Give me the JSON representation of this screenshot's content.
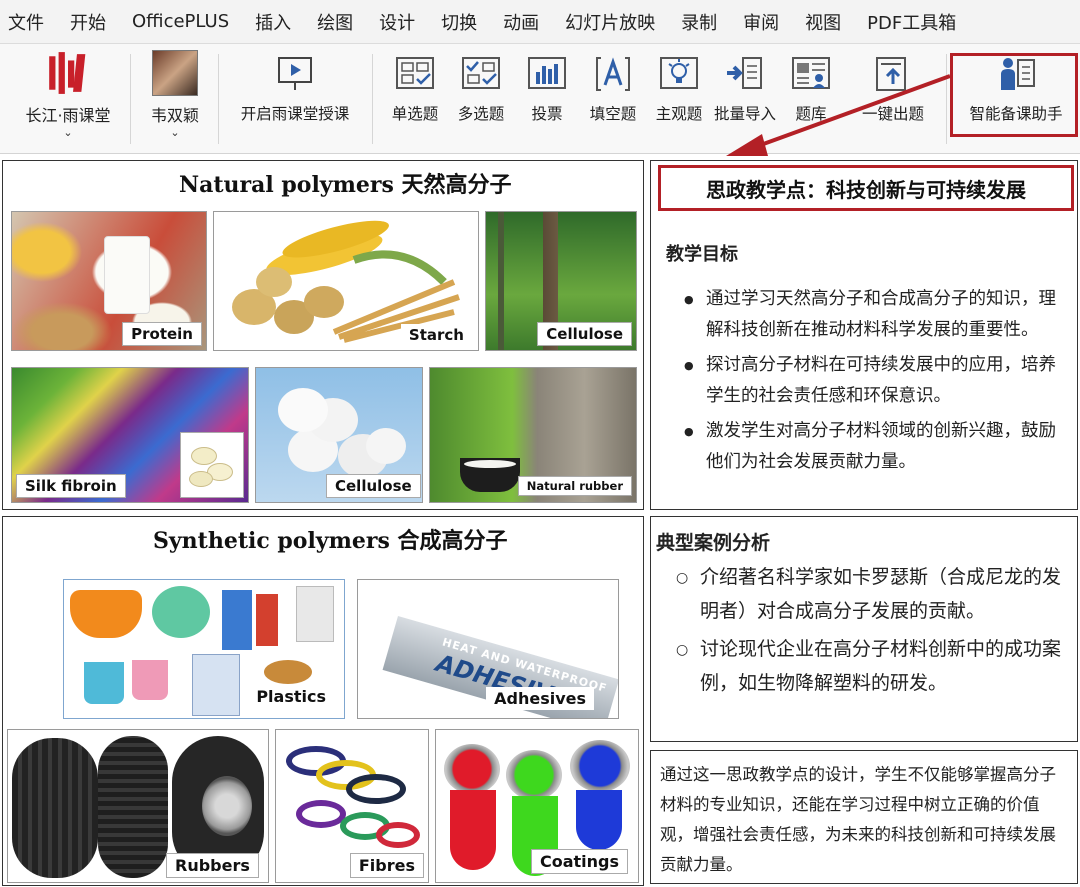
{
  "menubar": {
    "items": [
      "文件",
      "开始",
      "OfficePLUS",
      "插入",
      "绘图",
      "设计",
      "切换",
      "动画",
      "幻灯片放映",
      "录制",
      "审阅",
      "视图",
      "PDF工具箱"
    ]
  },
  "ribbon": {
    "rain_classroom": "长江·雨课堂",
    "user": "韦双颖",
    "start_lesson": "开启雨课堂授课",
    "buttons": [
      "单选题",
      "多选题",
      "投票",
      "填空题",
      "主观题",
      "批量导入",
      "题库",
      "一键出题"
    ],
    "assistant": "智能备课助手",
    "caret": "⌄"
  },
  "natural": {
    "title": "Natural polymers 天然高分子",
    "tags": [
      "Protein",
      "Starch",
      "Cellulose",
      "Silk fibroin",
      "Cellulose",
      "Natural rubber"
    ]
  },
  "synthetic": {
    "title": "Synthetic polymers  合成高分子",
    "tags": [
      "Plastics",
      "Adhesives",
      "Rubbers",
      "Fibres",
      "Coatings"
    ],
    "tube_text": "HEAT AND WATERPROOF",
    "tube_brand": "ADHESIVE"
  },
  "ideology": {
    "title": "思政教学点：科技创新与可持续发展",
    "goals_head": "教学目标",
    "goals": [
      "通过学习天然高分子和合成高分子的知识，理解科技创新在推动材料科学发展的重要性。",
      "探讨高分子材料在可持续发展中的应用，培养学生的社会责任感和环保意识。",
      "激发学生对高分子材料领域的创新兴趣，鼓励他们为社会发展贡献力量。"
    ],
    "cases_head": "典型案例分析",
    "cases": [
      "介绍著名科学家如卡罗瑟斯（合成尼龙的发明者）对合成高分子发展的贡献。",
      "讨论现代企业在高分子材料创新中的成功案例，如生物降解塑料的研发。"
    ],
    "summary": "通过这一思政教学点的设计，学生不仅能够掌握高分子材料的专业知识，还能在学习过程中树立正确的价值观，增强社会责任感，为未来的科技创新和可持续发展贡献力量。"
  },
  "colors": {
    "highlight": "#b32026",
    "ribbon_blue": "#2f5fa8",
    "logo_red": "#c8202a"
  }
}
